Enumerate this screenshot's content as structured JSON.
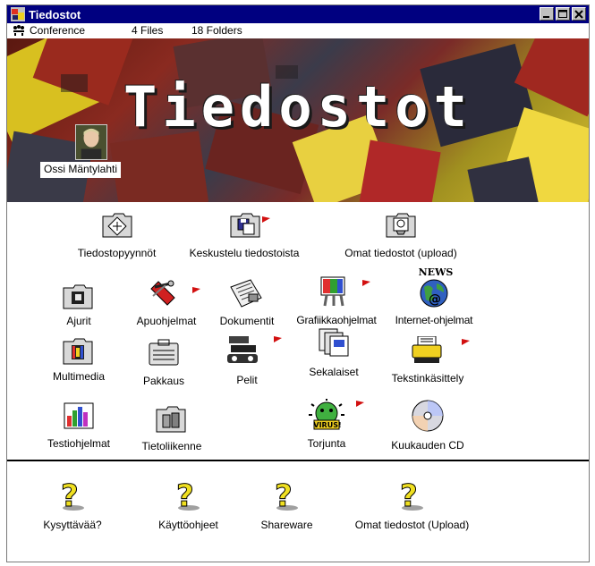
{
  "window": {
    "title": "Tiedostot"
  },
  "infobar": {
    "conference": "Conference",
    "files": "4 Files",
    "folders": "18 Folders"
  },
  "banner": {
    "title": "Tiedostot",
    "user": "Ossi Mäntylahti"
  },
  "items": {
    "tiedostopyynnot": "Tiedostopyynnöt",
    "keskustelu": "Keskustelu tiedostoista",
    "omat_upload_top": "Omat tiedostot (upload)",
    "ajurit": "Ajurit",
    "apuohjelmat": "Apuohjelmat",
    "dokumentit": "Dokumentit",
    "grafiikka": "Grafiikkaohjelmat",
    "internet": "Internet-ohjelmat",
    "multimedia": "Multimedia",
    "pakkaus": "Pakkaus",
    "pelit": "Pelit",
    "sekalaiset": "Sekalaiset",
    "tekstinkasittely": "Tekstinkäsittely",
    "testiohjelmat": "Testiohjelmat",
    "tietoliikenne": "Tietoliikenne",
    "torjunta": "Torjunta",
    "kuukauden_cd": "Kuukauden CD"
  },
  "bottom_items": {
    "kysyttavaa": "Kysyttävää?",
    "kayttoohjeet": "Käyttöohjeet",
    "shareware": "Shareware",
    "omat_upload_bottom": "Omat tiedostot (Upload)"
  },
  "icon_texts": {
    "news": "NEWS",
    "virus": "VIRUS!"
  },
  "colors": {
    "titlebar": "#000080",
    "flag": "#d21010"
  }
}
